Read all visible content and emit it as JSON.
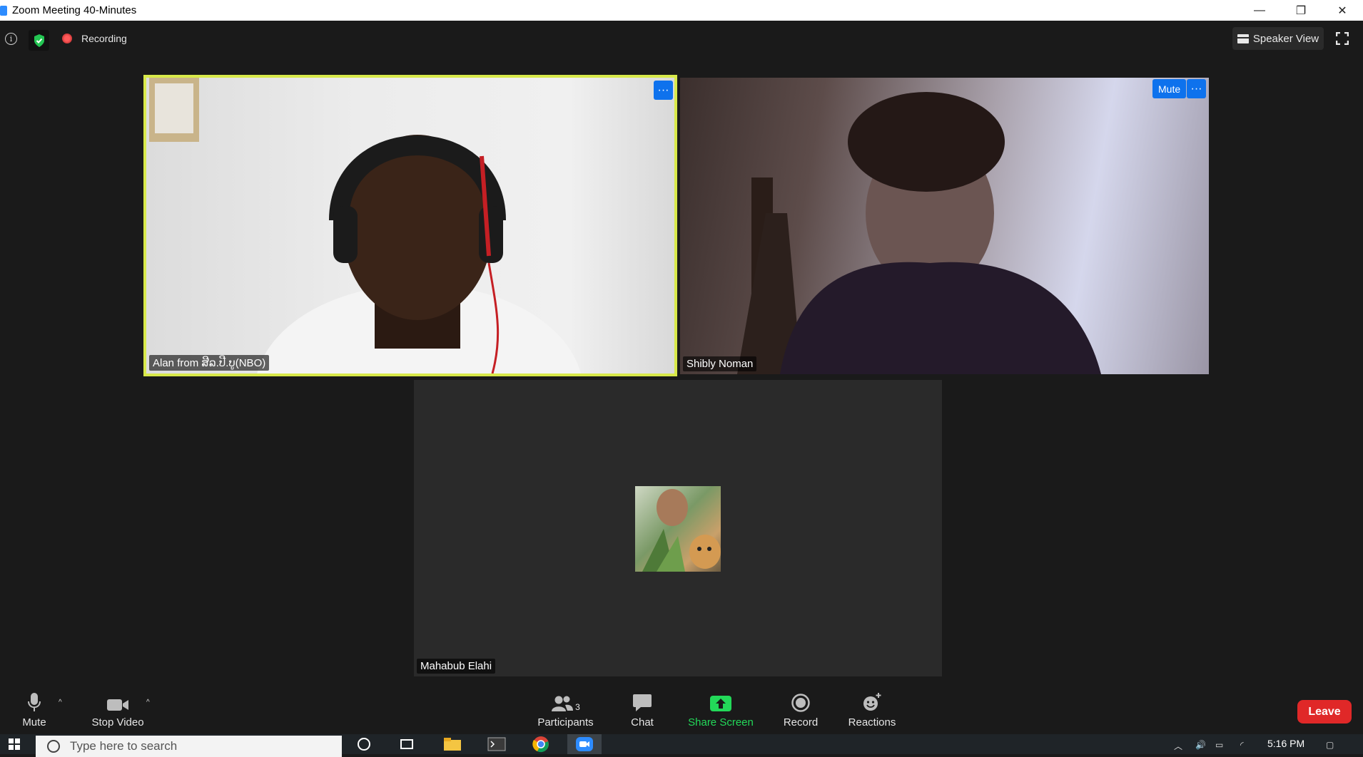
{
  "window": {
    "title": "Zoom Meeting 40-Minutes",
    "controls": {
      "minimize": "—",
      "restore": "❐",
      "close": "✕"
    }
  },
  "topbar": {
    "recording_label": "Recording",
    "speaker_view_label": "Speaker View"
  },
  "participants_tiles": [
    {
      "name": "Alan from ສີລ.ປີ.ບູ(NBO)",
      "active_speaker": true,
      "menu_label": "···"
    },
    {
      "name": "Shibly Noman",
      "mute_label": "Mute",
      "menu_label": "···"
    },
    {
      "name": "Mahabub Elahi"
    }
  ],
  "toolbar": {
    "mute_label": "Mute",
    "stop_video_label": "Stop Video",
    "participants_label": "Participants",
    "participants_count": "3",
    "chat_label": "Chat",
    "share_screen_label": "Share Screen",
    "record_label": "Record",
    "reactions_label": "Reactions",
    "leave_label": "Leave",
    "caret": "^"
  },
  "taskbar": {
    "search_placeholder": "Type here to search",
    "time": "5:16 PM"
  },
  "colors": {
    "active_speaker_border": "#d8e94a",
    "button_blue": "#0e72ed",
    "share_green": "#23d959",
    "leave_red": "#e02828"
  },
  "icons": [
    "info-icon",
    "shield-check-icon",
    "record-dot-icon",
    "grid-icon",
    "fullscreen-icon",
    "microphone-icon",
    "video-camera-icon",
    "participants-icon",
    "chat-icon",
    "share-screen-icon",
    "record-icon",
    "reactions-icon",
    "windows-start-icon",
    "search-icon",
    "task-view-icon",
    "file-explorer-icon",
    "terminal-icon",
    "chrome-icon",
    "zoom-app-icon",
    "volume-icon",
    "battery-icon",
    "wifi-icon",
    "notification-icon"
  ]
}
